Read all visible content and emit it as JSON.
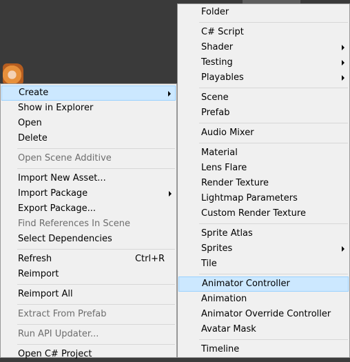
{
  "left_menu": {
    "items": [
      {
        "label": "Create",
        "submenu": true,
        "highlighted": true
      },
      {
        "label": "Show in Explorer"
      },
      {
        "label": "Open"
      },
      {
        "label": "Delete"
      },
      {
        "label": "Open Scene Additive",
        "disabled": true
      },
      {
        "label": "Import New Asset..."
      },
      {
        "label": "Import Package",
        "submenu": true
      },
      {
        "label": "Export Package..."
      },
      {
        "label": "Find References In Scene",
        "disabled": true
      },
      {
        "label": "Select Dependencies"
      },
      {
        "label": "Refresh",
        "shortcut": "Ctrl+R"
      },
      {
        "label": "Reimport"
      },
      {
        "label": "Reimport All"
      },
      {
        "label": "Extract From Prefab",
        "disabled": true
      },
      {
        "label": "Run API Updater...",
        "disabled": true
      },
      {
        "label": "Open C# Project"
      }
    ]
  },
  "right_menu": {
    "items": [
      {
        "label": "Folder"
      },
      {
        "label": "C# Script"
      },
      {
        "label": "Shader",
        "submenu": true
      },
      {
        "label": "Testing",
        "submenu": true
      },
      {
        "label": "Playables",
        "submenu": true
      },
      {
        "label": "Scene"
      },
      {
        "label": "Prefab"
      },
      {
        "label": "Audio Mixer"
      },
      {
        "label": "Material"
      },
      {
        "label": "Lens Flare"
      },
      {
        "label": "Render Texture"
      },
      {
        "label": "Lightmap Parameters"
      },
      {
        "label": "Custom Render Texture"
      },
      {
        "label": "Sprite Atlas"
      },
      {
        "label": "Sprites",
        "submenu": true
      },
      {
        "label": "Tile"
      },
      {
        "label": "Animator Controller",
        "highlighted": true
      },
      {
        "label": "Animation"
      },
      {
        "label": "Animator Override Controller"
      },
      {
        "label": "Avatar Mask"
      },
      {
        "label": "Timeline"
      }
    ]
  }
}
